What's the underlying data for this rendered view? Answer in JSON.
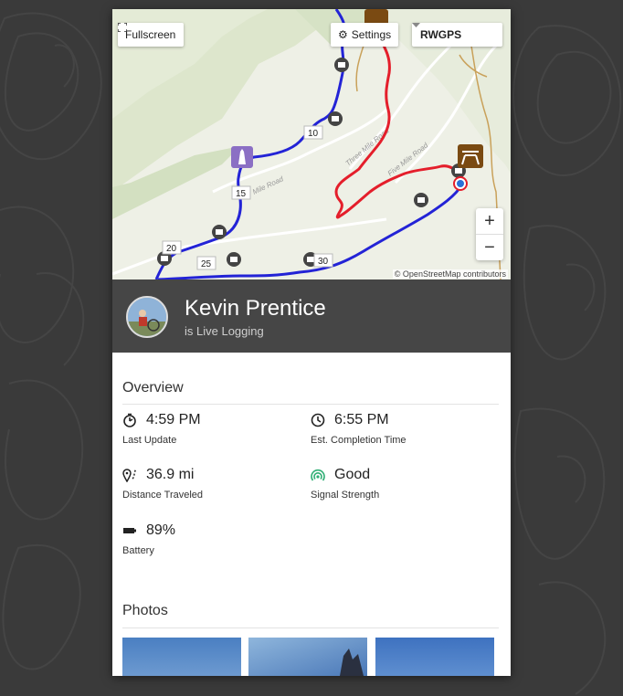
{
  "map": {
    "fullscreen_label": "Fullscreen",
    "settings_label": "Settings",
    "layer_select_value": "RWGPS",
    "zoom_in": "+",
    "zoom_out": "−",
    "attribution": "© OpenStreetMap contributors",
    "road_labels": [
      "Mile Road",
      "Three Mile Road",
      "Five Mile Road"
    ],
    "mile_markers": [
      "10",
      "15",
      "20",
      "25",
      "30"
    ],
    "colors": {
      "route_blue": "#2323d6",
      "route_red": "#e41e2b",
      "poi_purple": "#8b6fc4",
      "poi_brown": "#7a4a12"
    }
  },
  "rider": {
    "name": "Kevin Prentice",
    "status": "is Live Logging"
  },
  "overview": {
    "title": "Overview",
    "last_update": {
      "value": "4:59 PM",
      "label": "Last Update",
      "icon": "stopwatch-icon"
    },
    "completion": {
      "value": "6:55 PM",
      "label": "Est. Completion Time",
      "icon": "clock-icon"
    },
    "distance": {
      "value": "36.9 mi",
      "label": "Distance Traveled",
      "icon": "route-pin-icon"
    },
    "signal": {
      "value": "Good",
      "label": "Signal Strength",
      "icon": "signal-icon",
      "color": "#2fae74"
    },
    "battery": {
      "value": "89%",
      "label": "Battery",
      "icon": "battery-icon"
    }
  },
  "photos": {
    "title": "Photos",
    "count_visible": 3
  }
}
